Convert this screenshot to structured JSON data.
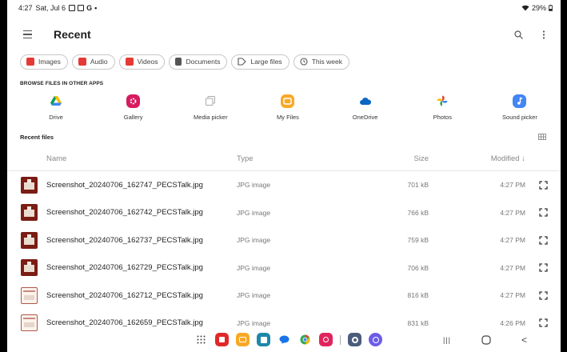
{
  "status": {
    "time": "4:27",
    "date": "Sat, Jul 6",
    "letter_icon": "G",
    "dot": "•",
    "battery": "29%"
  },
  "appbar": {
    "title": "Recent",
    "menu_icon": "hamburger-icon",
    "search_icon": "search-icon",
    "more_icon": "more-vert-icon"
  },
  "chips": [
    {
      "label": "Images",
      "icon": "image-icon",
      "color": "#e53935"
    },
    {
      "label": "Audio",
      "icon": "audio-icon",
      "color": "#e53935"
    },
    {
      "label": "Videos",
      "icon": "video-icon",
      "color": "#e53935"
    },
    {
      "label": "Documents",
      "icon": "document-icon",
      "color": "#555555"
    },
    {
      "label": "Large files",
      "icon": "tag-icon",
      "color": "#555555"
    },
    {
      "label": "This week",
      "icon": "history-icon",
      "color": "#555555"
    }
  ],
  "browse": {
    "label": "BROWSE FILES IN OTHER APPS",
    "apps": [
      {
        "label": "Drive",
        "icon": "drive-icon"
      },
      {
        "label": "Gallery",
        "icon": "gallery-icon",
        "color": "#d81b60"
      },
      {
        "label": "Media picker",
        "icon": "media-picker-icon",
        "color": "#9e9e9e"
      },
      {
        "label": "My Files",
        "icon": "my-files-icon",
        "color": "#f9a825"
      },
      {
        "label": "OneDrive",
        "icon": "onedrive-icon",
        "color": "#0a66c2"
      },
      {
        "label": "Photos",
        "icon": "photos-icon"
      },
      {
        "label": "Sound picker",
        "icon": "sound-picker-icon",
        "color": "#4285f4"
      }
    ]
  },
  "recent": {
    "label": "Recent files",
    "grid_icon": "grid-view-icon"
  },
  "table": {
    "headers": {
      "name": "Name",
      "type": "Type",
      "size": "Size",
      "modified": "Modified ↓"
    },
    "rows": [
      {
        "name": "Screenshot_20240706_162747_PECSTalk.jpg",
        "type": "JPG image",
        "size": "701 kB",
        "modified": "4:27 PM",
        "thumb": "dark"
      },
      {
        "name": "Screenshot_20240706_162742_PECSTalk.jpg",
        "type": "JPG image",
        "size": "766 kB",
        "modified": "4:27 PM",
        "thumb": "dark"
      },
      {
        "name": "Screenshot_20240706_162737_PECSTalk.jpg",
        "type": "JPG image",
        "size": "759 kB",
        "modified": "4:27 PM",
        "thumb": "dark"
      },
      {
        "name": "Screenshot_20240706_162729_PECSTalk.jpg",
        "type": "JPG image",
        "size": "706 kB",
        "modified": "4:27 PM",
        "thumb": "dark"
      },
      {
        "name": "Screenshot_20240706_162712_PECSTalk.jpg",
        "type": "JPG image",
        "size": "816 kB",
        "modified": "4:27 PM",
        "thumb": "light"
      },
      {
        "name": "Screenshot_20240706_162659_PECSTalk.jpg",
        "type": "JPG image",
        "size": "831 kB",
        "modified": "4:26 PM",
        "thumb": "light"
      }
    ]
  },
  "navbar": {
    "dock": [
      "apps-grid-icon",
      "flipboard-icon",
      "my-files-icon",
      "calendar-icon",
      "messages-icon",
      "chrome-icon",
      "camera-icon",
      "settings-icon",
      "internet-icon"
    ],
    "recents_key": "|||",
    "back_key": "<"
  }
}
